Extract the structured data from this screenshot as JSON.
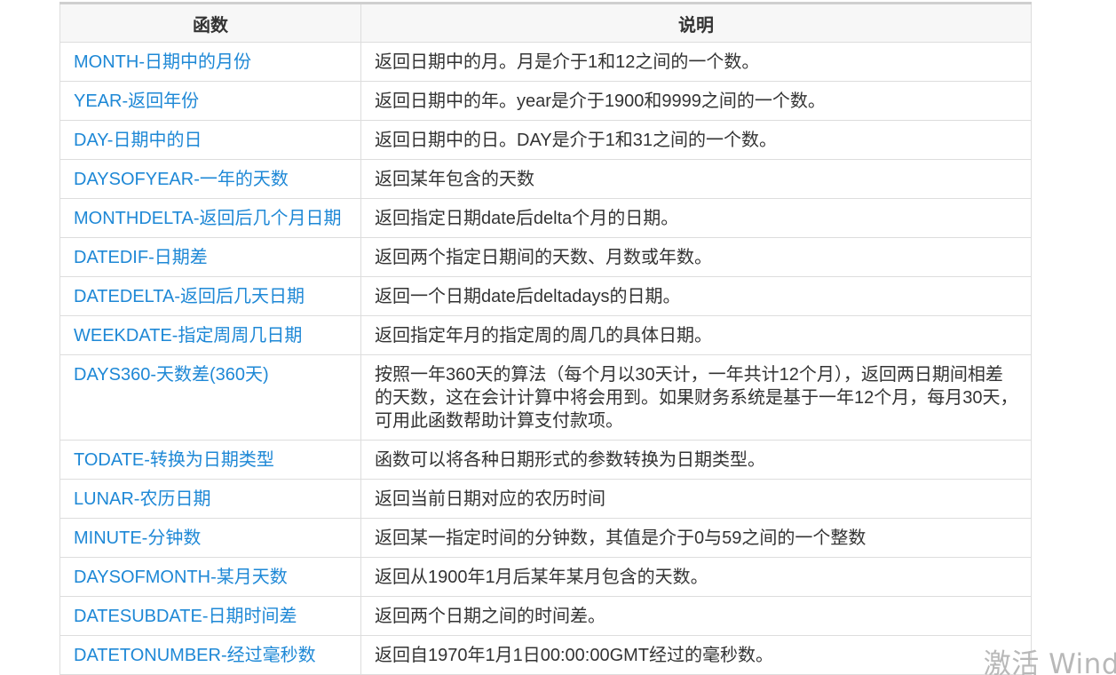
{
  "table": {
    "headers": {
      "function": "函数",
      "description": "说明"
    },
    "rows": [
      {
        "name": "MONTH-日期中的月份",
        "desc": "返回日期中的月。月是介于1和12之间的一个数。"
      },
      {
        "name": "YEAR-返回年份",
        "desc": "返回日期中的年。year是介于1900和9999之间的一个数。"
      },
      {
        "name": "DAY-日期中的日",
        "desc": "返回日期中的日。DAY是介于1和31之间的一个数。"
      },
      {
        "name": "DAYSOFYEAR-一年的天数",
        "desc": "返回某年包含的天数"
      },
      {
        "name": "MONTHDELTA-返回后几个月日期",
        "desc": "返回指定日期date后delta个月的日期。"
      },
      {
        "name": "DATEDIF-日期差",
        "desc": "返回两个指定日期间的天数、月数或年数。"
      },
      {
        "name": "DATEDELTA-返回后几天日期",
        "desc": "返回一个日期date后deltadays的日期。"
      },
      {
        "name": "WEEKDATE-指定周周几日期",
        "desc": "返回指定年月的指定周的周几的具体日期。"
      },
      {
        "name": "DAYS360-天数差(360天)",
        "desc": "按照一年360天的算法（每个月以30天计，一年共计12个月），返回两日期间相差的天数，这在会计计算中将会用到。如果财务系统是基于一年12个月，每月30天，可用此函数帮助计算支付款项。"
      },
      {
        "name": "TODATE-转换为日期类型",
        "desc": "函数可以将各种日期形式的参数转换为日期类型。"
      },
      {
        "name": "LUNAR-农历日期",
        "desc": "返回当前日期对应的农历时间"
      },
      {
        "name": "MINUTE-分钟数",
        "desc": "返回某一指定时间的分钟数，其值是介于0与59之间的一个整数"
      },
      {
        "name": "DAYSOFMONTH-某月天数",
        "desc": "返回从1900年1月后某年某月包含的天数。"
      },
      {
        "name": "DATESUBDATE-日期时间差",
        "desc": "返回两个日期之间的时间差。"
      },
      {
        "name": "DATETONUMBER-经过毫秒数",
        "desc": "返回自1970年1月1日00:00:00GMT经过的毫秒数。"
      }
    ]
  },
  "watermark": "激活 Wind"
}
